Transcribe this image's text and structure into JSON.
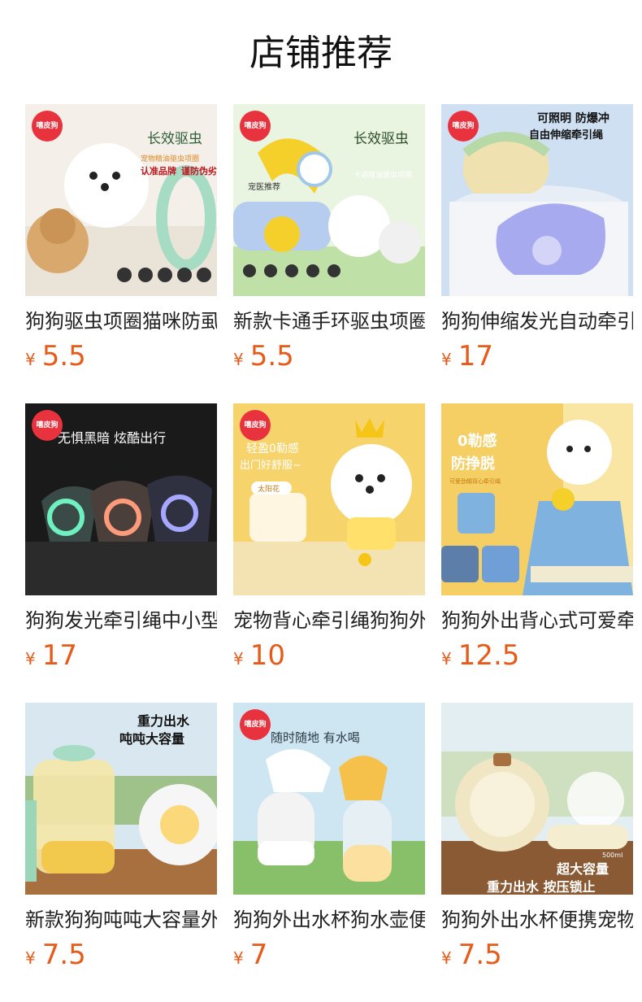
{
  "section": {
    "title": "店铺推荐"
  },
  "brand_badge": "嘻皮狗",
  "products": [
    {
      "name": "狗狗驱虫项圈猫咪防虱",
      "price": "5.5",
      "img_text": [
        "长效驱虫",
        "宠物精油驱虫项圈",
        "认准品牌",
        "谨防伪劣"
      ],
      "bg": "#f4efe8"
    },
    {
      "name": "新款卡通手环驱虫项圈",
      "price": "5.5",
      "img_text": [
        "长效驱虫",
        "卡通精油驱虫项圈",
        "宠医推荐"
      ],
      "bg": "#e9f4e1"
    },
    {
      "name": "狗狗伸缩发光自动牵引",
      "price": "17",
      "img_text": [
        "可照明 防爆冲",
        "自由伸缩牵引绳"
      ],
      "bg": "#cfe0f3"
    },
    {
      "name": "狗狗发光牵引绳中小型",
      "price": "17",
      "img_text": [
        "无惧黑暗 炫酷出行"
      ],
      "bg": "#1a1a1a"
    },
    {
      "name": "宠物背心牵引绳狗狗外",
      "price": "10",
      "img_text": [
        "轻盈0勒感",
        "出门好舒服~",
        "太阳花"
      ],
      "bg": "#f7d36c"
    },
    {
      "name": "狗狗外出背心式可爱牵",
      "price": "12.5",
      "img_text": [
        "0勒感",
        "防挣脱",
        "可爱劲帽背心牵引绳"
      ],
      "bg": "#f5cf64"
    },
    {
      "name": "新款狗狗吨吨大容量外",
      "price": "7.5",
      "img_text": [
        "重力出水",
        "吨吨大容量"
      ],
      "bg": "#d9e8f0"
    },
    {
      "name": "狗狗外出水杯狗水壶便",
      "price": "7",
      "img_text": [
        "随时随地 有水喝"
      ],
      "bg": "#cde6f2"
    },
    {
      "name": "狗狗外出水杯便携宠物",
      "price": "7.5",
      "img_text": [
        "超大容量",
        "重力出水 按压锁止",
        "500ml"
      ],
      "bg": "#e3eef2"
    }
  ],
  "currency_symbol": "¥",
  "colors": {
    "price": "#e85a18",
    "brand_red": "#e8333f"
  }
}
